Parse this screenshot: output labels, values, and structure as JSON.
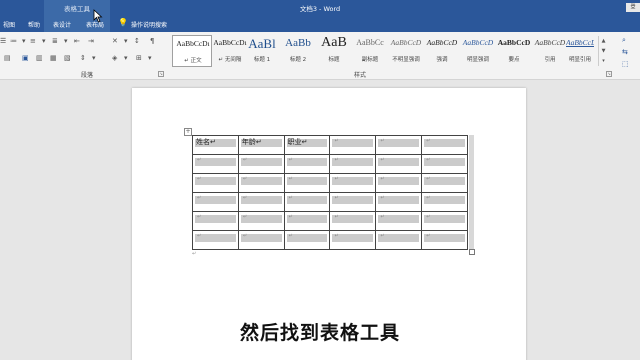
{
  "window": {
    "title": "文档3 - Word",
    "share_label": "登"
  },
  "context_tool": {
    "label": "表格工具"
  },
  "tabs": [
    "视图",
    "帮助",
    "表设计",
    "表布局"
  ],
  "tell_me": {
    "label": "操作说明搜索"
  },
  "ribbon": {
    "paragraph_group_label": "段落",
    "styles_group_label": "样式",
    "styles": [
      {
        "preview": "AaBbCcDı",
        "name": "↵ 正文"
      },
      {
        "preview": "AaBbCcDı",
        "name": "↵ 无间隔"
      },
      {
        "preview": "AaBl",
        "name": "标题 1"
      },
      {
        "preview": "AaBb",
        "name": "标题 2"
      },
      {
        "preview": "AaB",
        "name": "标题"
      },
      {
        "preview": "AaBbCc",
        "name": "副标题"
      },
      {
        "preview": "AaBbCcD",
        "name": "不明显强调"
      },
      {
        "preview": "AaBbCcD",
        "name": "强调"
      },
      {
        "preview": "AaBbCcD",
        "name": "明显强调"
      },
      {
        "preview": "AaBbCcD",
        "name": "要点"
      },
      {
        "preview": "AaBbCcD",
        "name": "引用"
      },
      {
        "preview": "AaBbCcD",
        "name": "明显引用"
      }
    ]
  },
  "table": {
    "header": [
      "姓名↵",
      "年龄↵",
      "职业↵",
      "↵",
      "↵",
      "↵"
    ],
    "empty_cell_mark": "↵",
    "row_count": 6
  },
  "paragraph_mark": "↵",
  "caption": "然后找到表格工具"
}
